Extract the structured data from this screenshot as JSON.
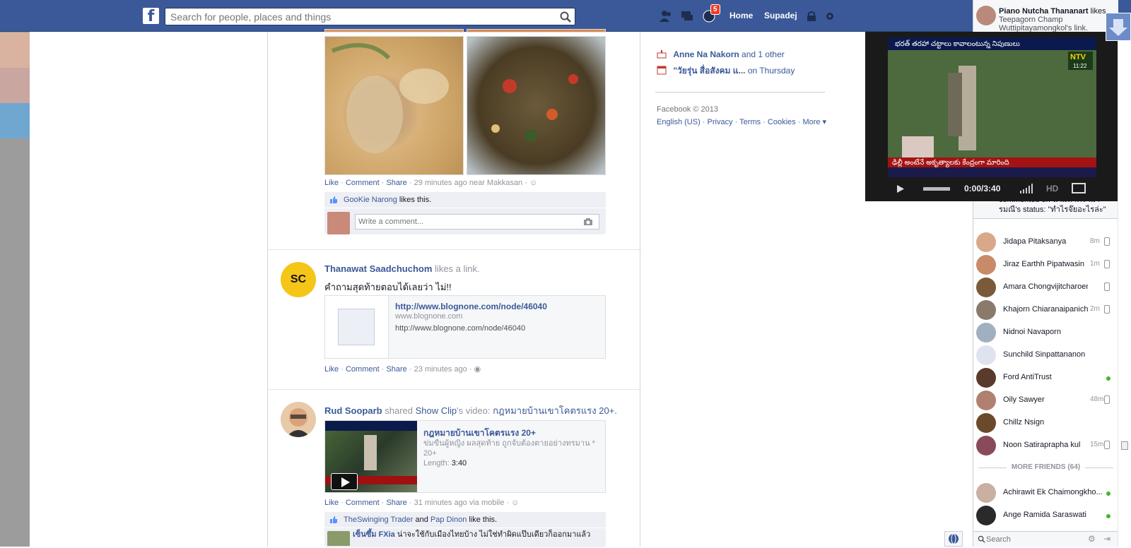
{
  "colors": {
    "brand": "#3b5998",
    "badge": "#f03d25",
    "online": "#42b72a"
  },
  "topbar": {
    "logo": "f",
    "search_placeholder": "Search for people, places and things",
    "notification_count": "5",
    "home_label": "Home",
    "profile_label": "Supadej"
  },
  "feed": {
    "story1": {
      "like": "Like",
      "comment": "Comment",
      "share": "Share",
      "meta": "· 29 minutes ago near Makkasan ·",
      "likes_name": "GooKie Narong",
      "likes_suffix": "likes this.",
      "comment_placeholder": "Write a comment..."
    },
    "story2": {
      "author": "Thanawat Saadchuchom",
      "verb": "likes a link.",
      "message": "คำถามสุดท้ายตอบได้เลยว่า ไม่!!",
      "avatar_text": "SC",
      "link_title": "http://www.blognone.com/node/46040",
      "link_domain": "www.blognone.com",
      "link_desc": "http://www.blognone.com/node/46040",
      "like": "Like",
      "comment": "Comment",
      "share": "Share",
      "meta": "· 23 minutes ago ·"
    },
    "story3": {
      "author": "Rud Sooparb",
      "verb_pre": "shared",
      "page": "Show Clip",
      "verb_mid": "'s video:",
      "video_title_link": "กฎหมายบ้านเขาโคตรแรง 20+.",
      "attach_title": "กฎหมายบ้านเขาโคตรแรง 20+",
      "attach_desc": "ข่มขืนผู้หญิง ผลสุดท้าย ถูกจับต้องตายอย่างทรมาน * 20+",
      "length_label": "Length:",
      "length_value": "3:40",
      "like": "Like",
      "comment": "Comment",
      "share": "Share",
      "meta": "· 31 minutes ago via mobile ·",
      "likes_a": "TheSwinging Trader",
      "likes_and": "and",
      "likes_b": "Pap Dinon",
      "likes_suffix": "like this.",
      "partial_comment_author": "เซ็นซึ้ม FXia",
      "partial_comment_text": "น่าจะใช้กับเมืองไทยบ้าง ไม่ใช่ทำผิดแป๊บเดียวก็ออกมาแล้ว"
    }
  },
  "sidebar": {
    "event1_name": "Anne Na Nakorn",
    "event1_rest": "and 1 other",
    "event2_name": "\"วัยรุ่น สื่อสังคม แ...",
    "event2_rest": "on Thursday",
    "footer_copy": "Facebook © 2013",
    "footer_links": [
      "English (US)",
      "Privacy",
      "Terms",
      "Cookies",
      "More"
    ]
  },
  "ticker": {
    "line1_name": "Piano Nutcha Thananart",
    "line1_verb": "likes",
    "line1_rest": "Teepagorn Champ Wuttipitayamongkol's link.",
    "line_bottom_a": "commented on น้ำมหาครามา",
    "line_bottom_b": "รมณี's status: \"ทำไรจ๊ยอะไรล่ะ\""
  },
  "video": {
    "time": "0:00/3:40",
    "hd": "HD",
    "channel": "NTV",
    "clock": "11:22",
    "caption_top": "భరత్ తరహా చట్టాలు కావాలంటున్న నిపుణులు",
    "caption_bottom": "ఢిల్లీ అంటేనే అకృత్యాలకు కేంద్రంగా మారింది"
  },
  "chat": {
    "friends": [
      {
        "name": "Jidapa Pitaksanya",
        "time": "8m",
        "status": "mobile"
      },
      {
        "name": "Jiraz Earthh Pipatwasin",
        "time": "1m",
        "status": "mobile"
      },
      {
        "name": "Amara Chongvijitcharoen",
        "time": "",
        "status": "mobile"
      },
      {
        "name": "Khajorn Chiaranaipanich",
        "time": "2m",
        "status": "mobile"
      },
      {
        "name": "Nidnoi Navaporn",
        "time": "",
        "status": "none"
      },
      {
        "name": "Sunchild Sinpattananon",
        "time": "",
        "status": "none"
      },
      {
        "name": "Ford AntiTrust",
        "time": "",
        "status": "online"
      },
      {
        "name": "Oily Sawyer",
        "time": "48m",
        "status": "mobile"
      },
      {
        "name": "Chillz Nsign",
        "time": "",
        "status": "none"
      },
      {
        "name": "Noon Satiraprapha kul",
        "time": "15m",
        "status": "mobile"
      }
    ],
    "more_friends_label": "MORE FRIENDS (64)",
    "more": [
      {
        "name": "Achirawit Ek Chaimongkho...",
        "status": "online"
      },
      {
        "name": "Ange Ramida Saraswati",
        "status": "online"
      }
    ],
    "search_placeholder": "Search"
  }
}
